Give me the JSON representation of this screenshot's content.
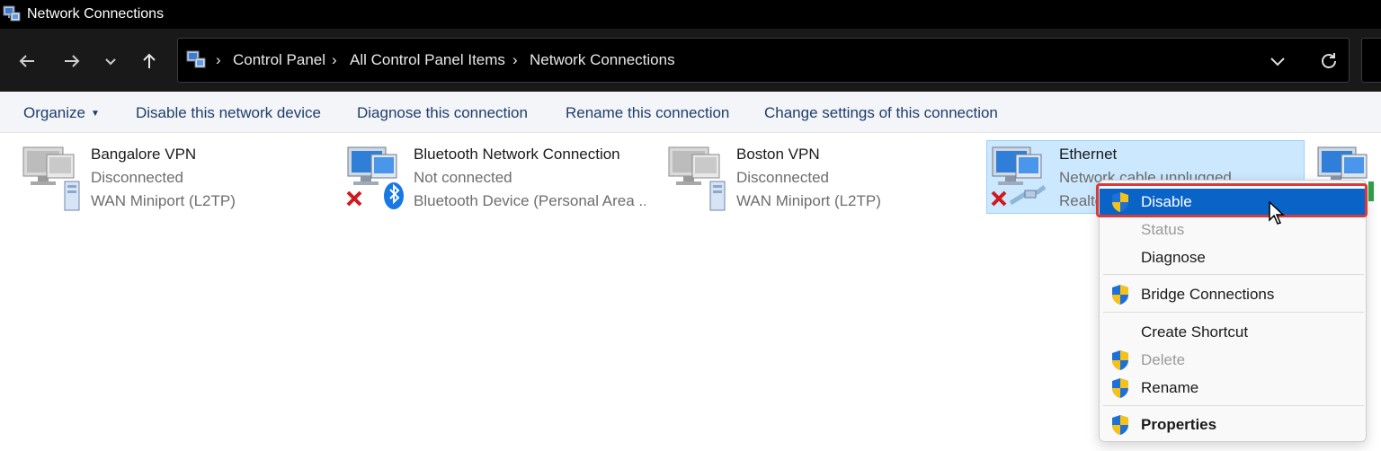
{
  "window": {
    "title": "Network Connections"
  },
  "nav": {
    "back_icon": "back-arrow-icon",
    "forward_icon": "forward-arrow-icon",
    "recent_icon": "chevron-down-icon",
    "up_icon": "up-arrow-icon",
    "breadcrumbs": [
      "Control Panel",
      "All Control Panel Items",
      "Network Connections"
    ],
    "separator": "›"
  },
  "toolbar": {
    "organize": "Organize",
    "disable_device": "Disable this network device",
    "diagnose": "Diagnose this connection",
    "rename": "Rename this connection",
    "change_settings": "Change settings of this connection"
  },
  "connections": [
    {
      "name": "Bangalore VPN",
      "status": "Disconnected",
      "device": "WAN Miniport (L2TP)"
    },
    {
      "name": "Bluetooth Network Connection",
      "status": "Not connected",
      "device": "Bluetooth Device (Personal Area ..."
    },
    {
      "name": "Boston VPN",
      "status": "Disconnected",
      "device": "WAN Miniport (L2TP)"
    },
    {
      "name": "Ethernet",
      "status": "Network cable unplugged",
      "device": "Realtek"
    }
  ],
  "context_menu": {
    "items": [
      {
        "label": "Disable",
        "shield": true,
        "enabled": true,
        "highlighted": true
      },
      {
        "label": "Status",
        "shield": false,
        "enabled": false
      },
      {
        "label": "Diagnose",
        "shield": false,
        "enabled": true
      },
      {
        "label": "Bridge Connections",
        "shield": true,
        "enabled": true
      },
      {
        "label": "Create Shortcut",
        "shield": false,
        "enabled": true
      },
      {
        "label": "Delete",
        "shield": true,
        "enabled": false
      },
      {
        "label": "Rename",
        "shield": true,
        "enabled": true
      },
      {
        "label": "Properties",
        "shield": true,
        "enabled": true,
        "bold": true
      }
    ]
  },
  "colors": {
    "titlebar": "#000000",
    "navbar": "#191919",
    "toolbar_bg": "#f3f5f9",
    "toolbar_text": "#1e3d6b",
    "selection": "#cce8ff",
    "menu_highlight": "#0a64c8",
    "callout_frame": "#d63b3b"
  }
}
